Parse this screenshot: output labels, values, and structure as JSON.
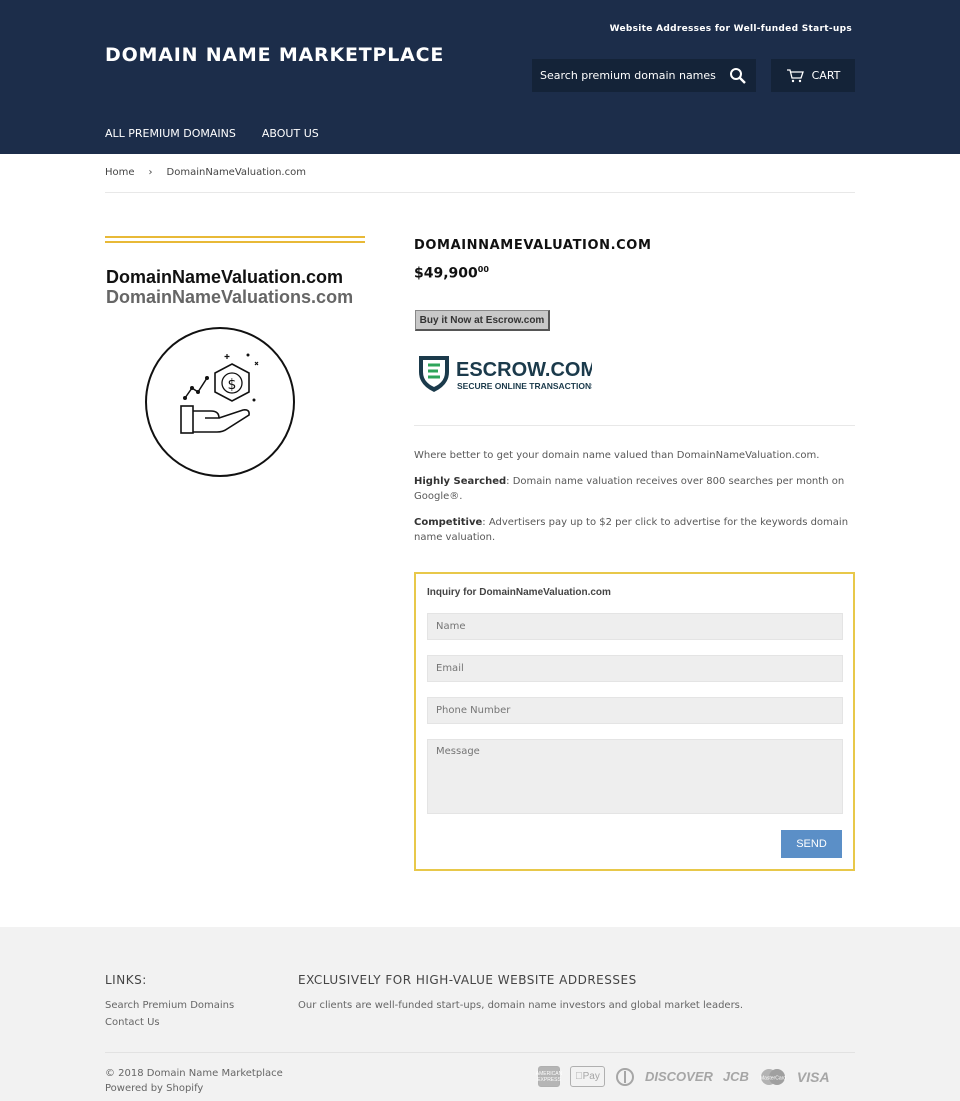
{
  "header": {
    "tagline": "Website Addresses for Well-funded Start-ups",
    "logo": "DOMAIN NAME MARKETPLACE",
    "search_placeholder": "Search premium domain names",
    "cart_label": "CART",
    "nav": [
      "ALL PREMIUM DOMAINS",
      "ABOUT US"
    ]
  },
  "breadcrumb": {
    "home": "Home",
    "separator": "›",
    "current": "DomainNameValuation.com"
  },
  "product_image": {
    "line1": "DomainNameValuation.com",
    "line2": "DomainNameValuations.com"
  },
  "product": {
    "title": "DOMAINNAMEVALUATION.COM",
    "price_main": "$49,900",
    "price_cents": "00",
    "buy_button": "Buy it Now at Escrow.com",
    "escrow_name": "ESCROW.COM",
    "escrow_tagline": "SECURE ONLINE TRANSACTIONS",
    "description": {
      "intro": "Where better to get your domain name valued than DomainNameValuation.com.",
      "p1_label": "Highly Searched",
      "p1_text": ": Domain name valuation receives over 800 searches per month on Google®.",
      "p2_label": "Competitive",
      "p2_text": ": Advertisers pay up to $2 per click to advertise for the keywords domain name valuation."
    }
  },
  "inquiry": {
    "title": "Inquiry for DomainNameValuation.com",
    "name_placeholder": "Name",
    "email_placeholder": "Email",
    "phone_placeholder": "Phone Number",
    "message_placeholder": "Message",
    "send_label": "SEND"
  },
  "footer": {
    "links_heading": "LINKS:",
    "links": [
      "Search Premium Domains",
      "Contact Us"
    ],
    "about_heading": "EXCLUSIVELY FOR HIGH-VALUE WEBSITE ADDRESSES",
    "about_text": "Our clients are well-funded start-ups, domain name investors and global market leaders.",
    "copyright": "© 2018 Domain Name Marketplace",
    "powered": "Powered by Shopify",
    "payments": [
      "AMERICAN EXPRESS",
      "Pay",
      "DISCOVER",
      "JCB",
      "MasterCard",
      "VISA"
    ]
  },
  "colors": {
    "header_bg": "#1c2d4a",
    "accent_gold": "#e8b937",
    "send_button": "#5b8fc7",
    "footer_bg": "#f2f2f2"
  }
}
